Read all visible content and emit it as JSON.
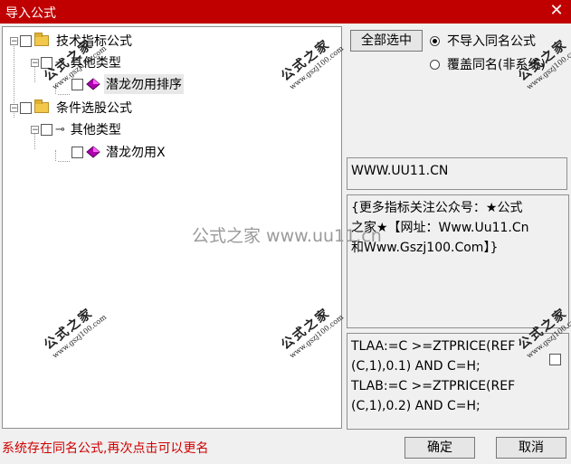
{
  "window": {
    "title": "导入公式",
    "close_glyph": "✕"
  },
  "tree": {
    "nodes": [
      {
        "label": "技术指标公式",
        "expander": "−"
      },
      {
        "label": "其他类型",
        "expander": "−"
      },
      {
        "label": "潜龙勿用排序"
      },
      {
        "label": "条件选股公式",
        "expander": "−"
      },
      {
        "label": "其他类型",
        "expander": "−"
      },
      {
        "label": "潜龙勿用X"
      }
    ]
  },
  "buttons": {
    "select_all": "全部选中",
    "ok": "确定",
    "cancel": "取消"
  },
  "options": [
    {
      "label": "不导入同名公式",
      "selected": true
    },
    {
      "label": "覆盖同名(非系统)",
      "selected": false
    }
  ],
  "url_text": "WWW.UU11.CN",
  "description_lines": [
    "{更多指标关注公众号：★公式",
    "之家★【网址：Www.Uu11.Cn",
    "和Www.Gszj100.Com】}"
  ],
  "code_lines": [
    "TLAA:=C >=ZTPRICE(REF",
    "(C,1),0.1) AND C=H;",
    "TLAB:=C >=ZTPRICE(REF",
    "(C,1),0.2) AND C=H;"
  ],
  "status_text": "系统存在同名公式,再次点击可以更名",
  "watermarks": {
    "brand": "公式之家",
    "site": "www.gszj100.com",
    "center": "公式之家 www.uu11.cn"
  },
  "colors": {
    "title_bar": "#c00000",
    "status_text": "#d00000"
  }
}
